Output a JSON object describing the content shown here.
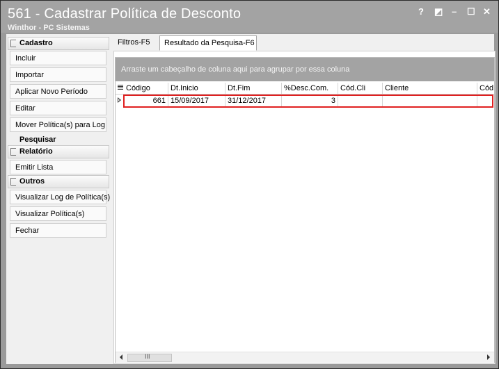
{
  "window": {
    "title": "561 - Cadastrar Política de Desconto",
    "subtitle": "Winthor - PC Sistemas",
    "controls": {
      "help": "?",
      "restore": "◩",
      "minimize": "–",
      "maximize": "☐",
      "close": "✕"
    }
  },
  "sidebar": {
    "cadastro": {
      "header": "Cadastro",
      "items": [
        "Incluir",
        "Importar",
        "Aplicar Novo Período",
        "Editar",
        "Mover Política(s) para Log"
      ]
    },
    "pesquisar": {
      "header": "Pesquisar"
    },
    "relatorio": {
      "header": "Relatório",
      "items": [
        "Emitir Lista"
      ]
    },
    "outros": {
      "header": "Outros",
      "items": [
        "Visualizar Log de Política(s)",
        "Visualizar Política(s)",
        "Fechar"
      ]
    }
  },
  "tabs": [
    {
      "label": "Filtros-F5",
      "active": false
    },
    {
      "label": "Resultado da Pesquisa-F6",
      "active": true
    }
  ],
  "grid": {
    "group_hint": "Arraste um cabeçalho de coluna aqui para agrupar por essa coluna",
    "columns": [
      "Código",
      "Dt.Inicio",
      "Dt.Fim",
      "%Desc.Com.",
      "Cód.Cli",
      "Cliente",
      "Cód"
    ],
    "rows": [
      {
        "codigo": "661",
        "dt_inicio": "15/09/2017",
        "dt_fim": "31/12/2017",
        "desc_com": "3",
        "cod_cli": "",
        "cliente": "",
        "cod": ""
      }
    ],
    "scroll_thumb": "III"
  },
  "colors": {
    "titlebar": "#a3a3a3",
    "group_bar": "#a3a3a3",
    "selection_border": "#e02020"
  }
}
